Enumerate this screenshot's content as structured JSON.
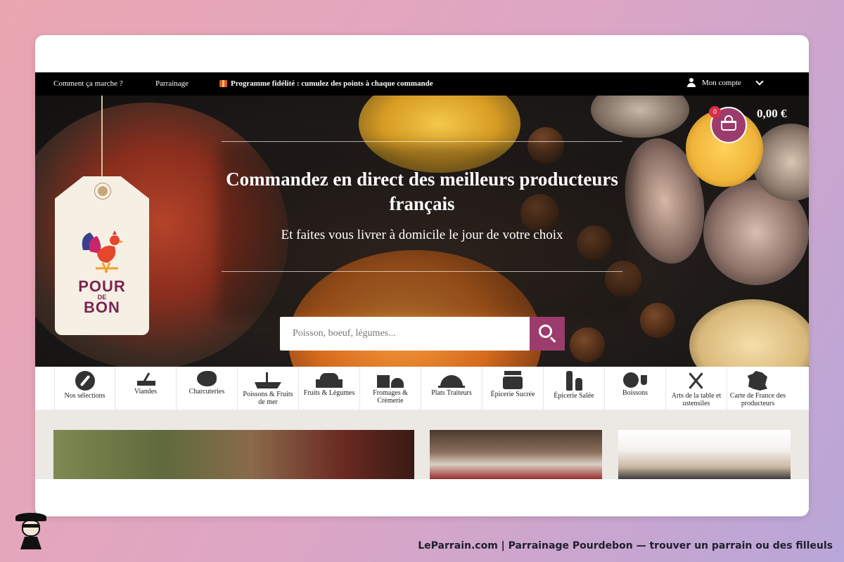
{
  "topbar": {
    "how_it_works": "Comment ça marche ?",
    "referral": "Parrainage",
    "promo": "Programme fidélité : cumulez des points à chaque commande",
    "account": "Mon compte"
  },
  "brand": {
    "logo_top": "POUR",
    "logo_mid": "DE",
    "logo_bottom": "BON",
    "logo_color": "#7a2552"
  },
  "hero": {
    "title": "Commandez en direct des meilleurs producteurs français",
    "subtitle": "Et faites vous livrer à domicile le jour de votre choix",
    "search_placeholder": "Poisson, boeuf, légumes...",
    "accent": "#9c3c6d"
  },
  "cart": {
    "count": "0",
    "total": "0,00 €"
  },
  "categories": [
    {
      "label": "Nos sélections",
      "icon": "compass-icon"
    },
    {
      "label": "Viandes",
      "icon": "cleaver-icon"
    },
    {
      "label": "Charcuteries",
      "icon": "ham-icon"
    },
    {
      "label": "Poissons & Fruits de mer",
      "icon": "boat-icon"
    },
    {
      "label": "Fruits & Légumes",
      "icon": "crate-icon"
    },
    {
      "label": "Fromages & Crèmerie",
      "icon": "cheese-icon"
    },
    {
      "label": "Plats Traiteurs",
      "icon": "cloche-icon"
    },
    {
      "label": "Épicerie Sucrée",
      "icon": "jar-icon"
    },
    {
      "label": "Épicerie Salée",
      "icon": "bottle-icon"
    },
    {
      "label": "Boissons",
      "icon": "barrel-icon"
    },
    {
      "label": "Arts de la table et ustensiles",
      "icon": "utensils-icon"
    },
    {
      "label": "Carte de France des producteurs",
      "icon": "france-map-icon"
    }
  ],
  "footer": {
    "caption": "LeParrain.com | Parrainage Pourdebon — trouver un parrain ou des filleuls"
  }
}
